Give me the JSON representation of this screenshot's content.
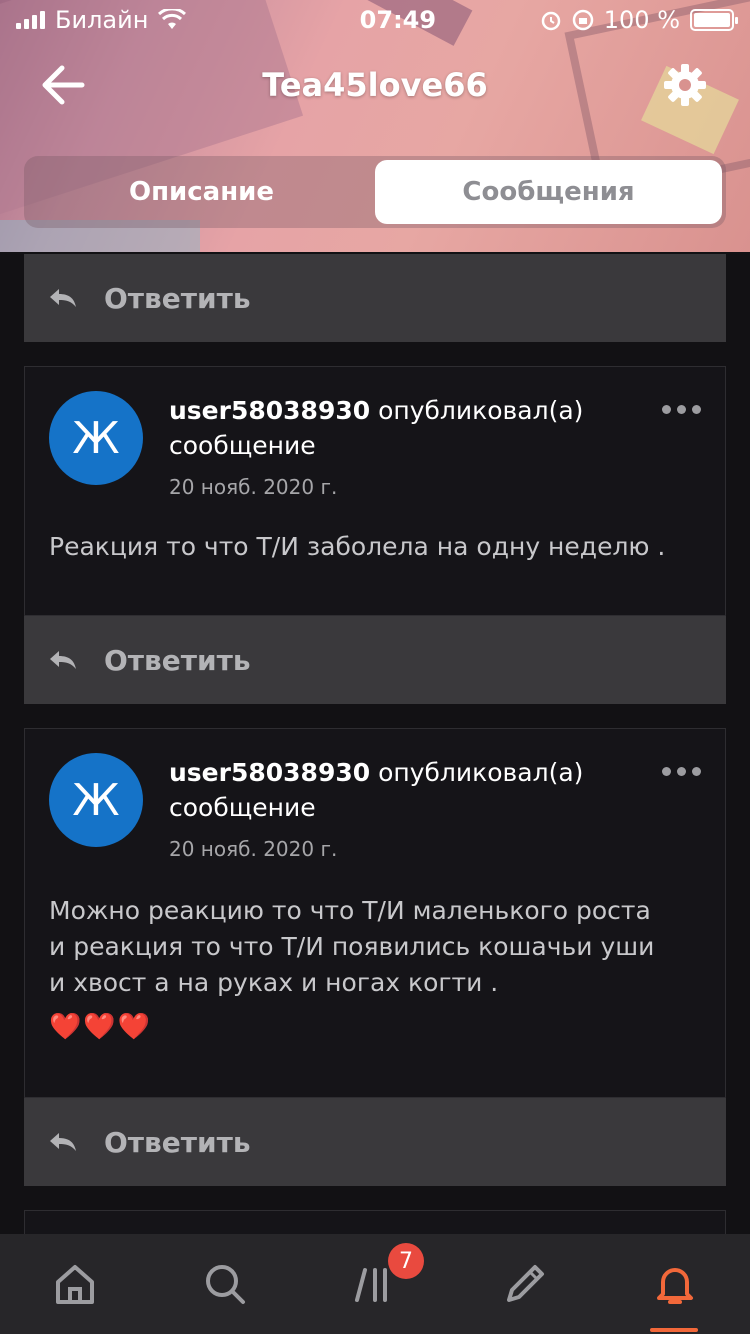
{
  "status_bar": {
    "carrier": "Билайн",
    "time": "07:49",
    "battery": "100 %",
    "battery_fraction": 1.0
  },
  "header": {
    "title": "Tea45love66",
    "back_icon": "arrow-left-icon",
    "settings_icon": "gear-icon"
  },
  "tabs": [
    {
      "label": "Описание",
      "active": false
    },
    {
      "label": "Сообщения",
      "active": true
    }
  ],
  "reply_label": "Ответить",
  "posts": [
    {
      "avatar_letter": "Ж",
      "user": "user58038930",
      "action": " опубликовал(а) сообщение",
      "date": "20 нояб. 2020 г.",
      "text": "Реакция то что Т/И заболела на одну неделю ."
    },
    {
      "avatar_letter": "Ж",
      "user": "user58038930",
      "action": " опубликовал(а) сообщение",
      "date": "20 нояб. 2020 г.",
      "text": "Можно реакцию то что Т/И маленького роста и реакция то что Т/И  появились кошачьи уши и хвост а на руках и ногах когти .",
      "hearts": "❤️❤️❤️"
    }
  ],
  "tab_bar": {
    "items": [
      "home-icon",
      "search-icon",
      "feed-icon",
      "pencil-icon",
      "bell-icon"
    ],
    "badge": "7",
    "active": "bell-icon"
  },
  "colors": {
    "accent": "#f2683a",
    "badge": "#e94a3f",
    "avatar": "#1573c8",
    "background": "#121114"
  }
}
